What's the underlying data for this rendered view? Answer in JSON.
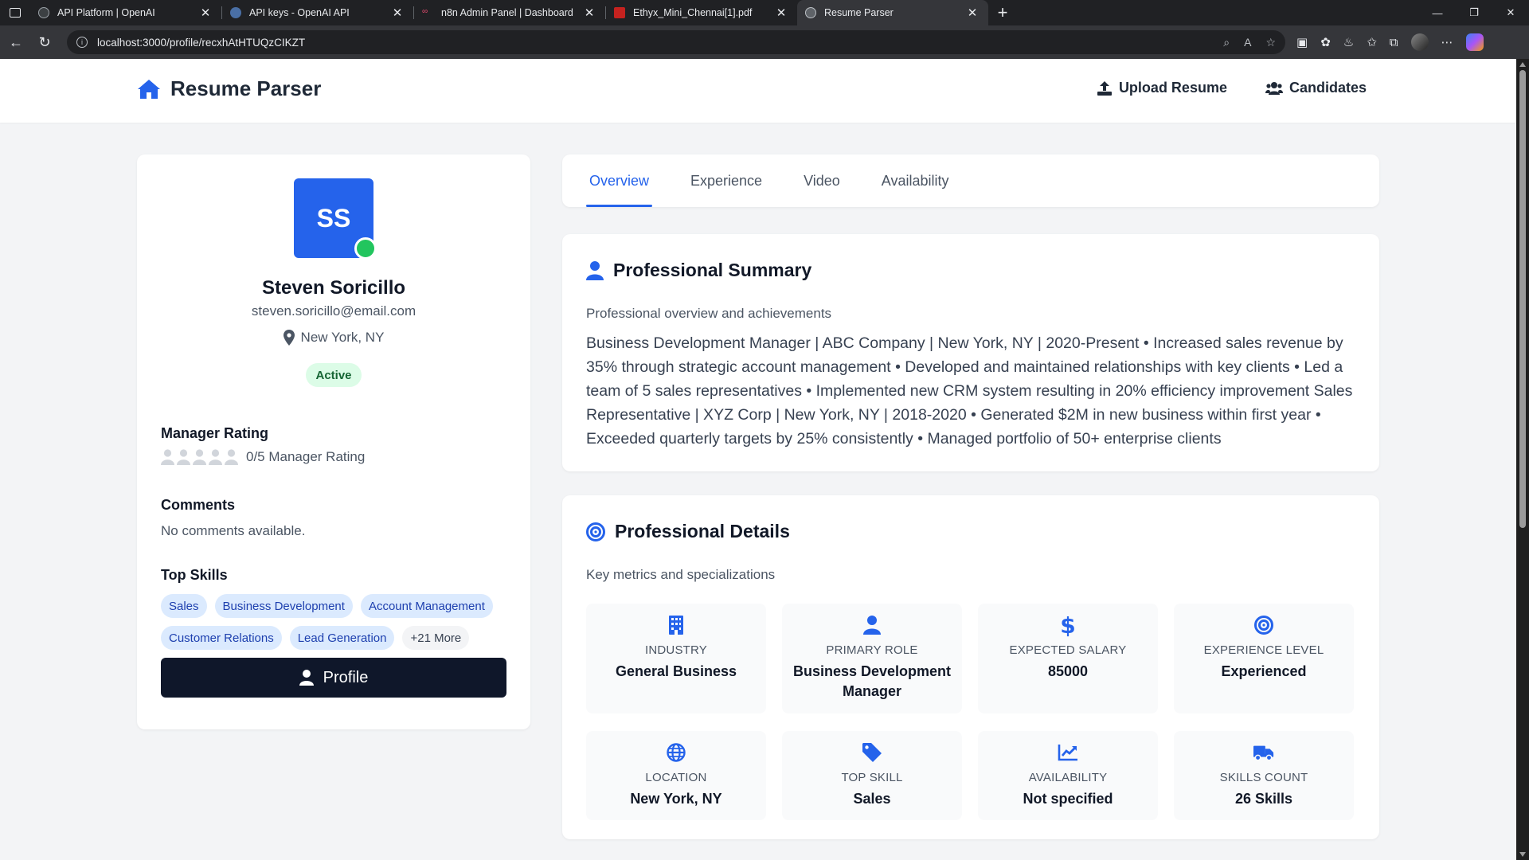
{
  "browser": {
    "tabs": [
      {
        "title": "API Platform | OpenAI",
        "favicon_color": "#3c4043",
        "active": false
      },
      {
        "title": "API keys - OpenAI API",
        "favicon_color": "#4a6fa5",
        "active": false
      },
      {
        "title": "n8n Admin Panel | Dashboard",
        "favicon_color": "#ea4b71",
        "active": false
      },
      {
        "title": "Ethyx_Mini_Chennai[1].pdf",
        "favicon_color": "#c5221f",
        "active": false
      },
      {
        "title": "Resume Parser",
        "favicon_color": "#5f6368",
        "active": true
      }
    ],
    "url": "localhost:3000/profile/recxhAtHTUQzCIKZT"
  },
  "app": {
    "title": "Resume Parser",
    "nav": {
      "upload": "Upload Resume",
      "candidates": "Candidates"
    },
    "accent": "#2563eb"
  },
  "profile": {
    "initials": "SS",
    "name": "Steven Soricillo",
    "email": "steven.soricillo@email.com",
    "location": "New York, NY",
    "status": "Active",
    "manager_rating_heading": "Manager Rating",
    "rating_value": 0,
    "rating_max": 5,
    "rating_text": "0/5 Manager Rating",
    "comments_heading": "Comments",
    "comments_text": "No comments available.",
    "skills_heading": "Top Skills",
    "skills": [
      "Sales",
      "Business Development",
      "Account Management",
      "Customer Relations",
      "Lead Generation"
    ],
    "more_skills": "+21 More",
    "profile_button": "Profile"
  },
  "tabs": [
    "Overview",
    "Experience",
    "Video",
    "Availability"
  ],
  "active_tab": "Overview",
  "summary": {
    "title": "Professional Summary",
    "subtitle": "Professional overview and achievements",
    "body": "Business Development Manager | ABC Company | New York, NY | 2020-Present • Increased sales revenue by 35% through strategic account management • Developed and maintained relationships with key clients • Led a team of 5 sales representatives • Implemented new CRM system resulting in 20% efficiency improvement Sales Representative | XYZ Corp | New York, NY | 2018-2020 • Generated $2M in new business within first year • Exceeded quarterly targets by 25% consistently • Managed portfolio of 50+ enterprise clients"
  },
  "details": {
    "title": "Professional Details",
    "subtitle": "Key metrics and specializations",
    "stats": [
      {
        "icon": "building-icon",
        "label": "Industry",
        "value": "General Business"
      },
      {
        "icon": "user-icon",
        "label": "Primary Role",
        "value": "Business Development Manager"
      },
      {
        "icon": "dollar-icon",
        "label": "Expected Salary",
        "value": "85000"
      },
      {
        "icon": "target-icon",
        "label": "Experience Level",
        "value": "Experienced"
      },
      {
        "icon": "globe-icon",
        "label": "Location",
        "value": "New York, NY"
      },
      {
        "icon": "tag-icon",
        "label": "Top Skill",
        "value": "Sales"
      },
      {
        "icon": "chart-line-icon",
        "label": "Availability",
        "value": "Not specified"
      },
      {
        "icon": "truck-icon",
        "label": "Skills Count",
        "value": "26 Skills"
      }
    ]
  }
}
